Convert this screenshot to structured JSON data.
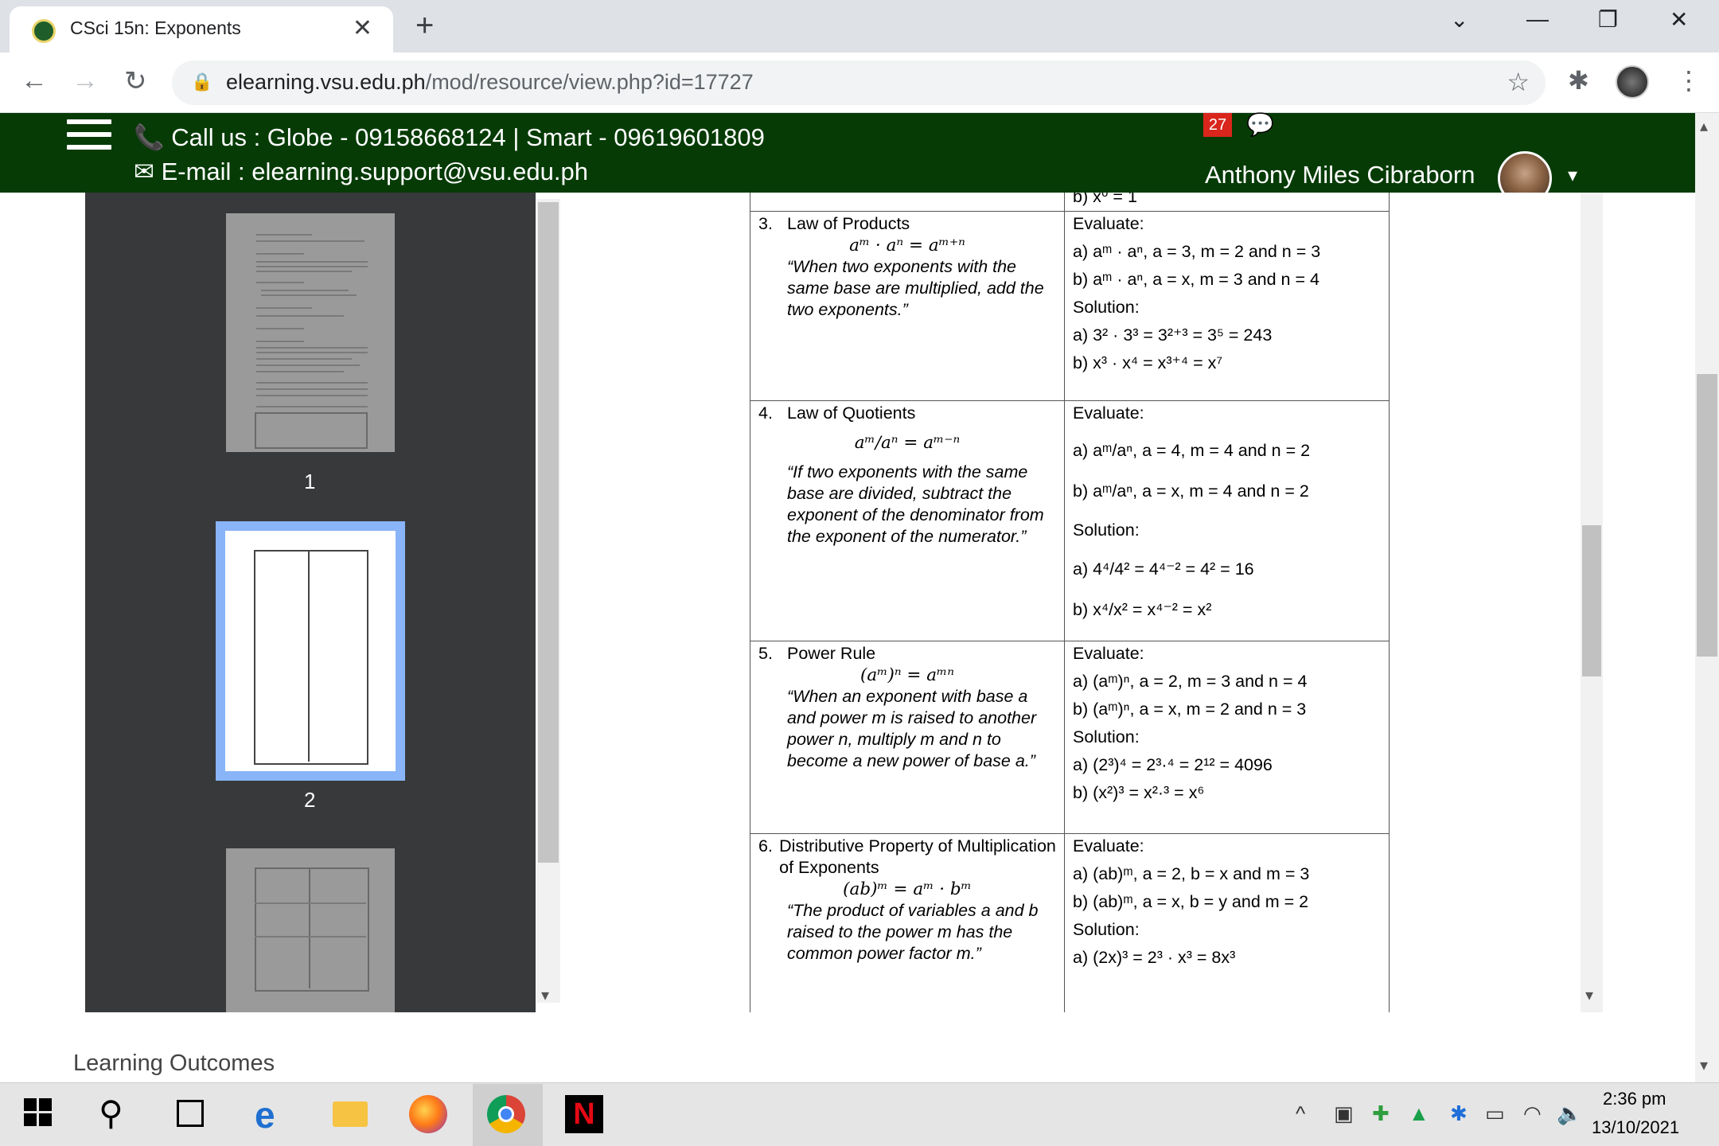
{
  "browser": {
    "tab_title": "CSci 15n: Exponents",
    "tab_close": "✕",
    "new_tab": "+",
    "window_controls": [
      "⌄",
      "—",
      "❐",
      "✕"
    ],
    "nav": {
      "back": "←",
      "forward": "→",
      "reload": "↻"
    },
    "url_host": "elearning.vsu.edu.ph",
    "url_path": "/mod/resource/view.php?id=17727",
    "lock": "🔒",
    "star": "☆",
    "extensions": "✱",
    "menu": "⋮"
  },
  "site": {
    "call_line": "📞 Call us : Globe - 09158668124 | Smart - 09619601809",
    "email_line": "✉ E-mail : elearning.support@vsu.edu.ph",
    "notification_count": "27",
    "user_name": "Anthony Miles Cibraborn",
    "dropdown": "▾"
  },
  "viewer": {
    "pages": [
      "1",
      "2"
    ],
    "scroll_up": "▴",
    "scroll_down": "▾"
  },
  "laws": [
    {
      "top_partial": "b) x⁰ = 1"
    },
    {
      "num": "3.",
      "name": "Law of Products",
      "formula": "aᵐ · aⁿ = aᵐ⁺ⁿ",
      "quote": "“When two exponents with the same base are multiplied, add the two exponents.”",
      "right": [
        "Evaluate:",
        "a) aᵐ · aⁿ, a = 3, m = 2 and n = 3",
        "b) aᵐ · aⁿ, a = x, m = 3 and n = 4",
        "Solution:",
        "a) 3² · 3³ = 3²⁺³ = 3⁵ = 243",
        "b) x³ · x⁴ = x³⁺⁴ = x⁷"
      ]
    },
    {
      "num": "4.",
      "name": "Law of Quotients",
      "formula": "aᵐ/aⁿ = aᵐ⁻ⁿ",
      "quote": "“If two exponents with the same base are divided, subtract the exponent of the denominator from the exponent of the numerator.”",
      "right": [
        "Evaluate:",
        "a) aᵐ/aⁿ, a = 4, m = 4 and n = 2",
        "b) aᵐ/aⁿ, a = x, m = 4 and n = 2",
        "Solution:",
        "a) 4⁴/4² = 4⁴⁻² = 4² = 16",
        "b) x⁴/x² = x⁴⁻² = x²"
      ]
    },
    {
      "num": "5.",
      "name": "Power Rule",
      "formula": "(aᵐ)ⁿ = aᵐⁿ",
      "quote": "“When an exponent with base a and power m is raised to another power n, multiply m and n to become a new power of base a.”",
      "right": [
        "Evaluate:",
        "a) (aᵐ)ⁿ, a = 2, m = 3 and n = 4",
        "b) (aᵐ)ⁿ, a = x, m = 2 and n = 3",
        "Solution:",
        "a) (2³)⁴ = 2³·⁴ = 2¹² = 4096",
        "b) (x²)³ = x²·³ = x⁶"
      ]
    },
    {
      "num": "6.",
      "name": "Distributive Property of Multiplication of Exponents",
      "formula": "(ab)ᵐ = aᵐ · bᵐ",
      "quote": "“The product of variables a and b raised to the power m has the common power factor m.”",
      "right": [
        "Evaluate:",
        "a) (ab)ᵐ, a = 2, b = x and m = 3",
        "b) (ab)ᵐ, a = x, b = y and m = 2",
        "Solution:",
        "a) (2x)³ = 2³ · x³ = 8x³"
      ]
    }
  ],
  "below": {
    "learning_outcomes": "Learning Outcomes"
  },
  "taskbar": {
    "time": "2:36 pm",
    "date": "13/10/2021",
    "search": "⚲",
    "tray_up": "^"
  }
}
